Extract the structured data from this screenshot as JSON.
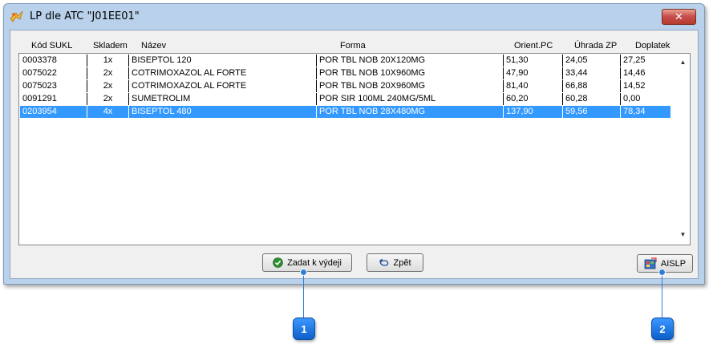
{
  "window": {
    "title": "LP dle ATC \"J01EE01\"",
    "close_label": "✕"
  },
  "columns": [
    "Kód SUKL",
    "Skladem",
    "Název",
    "Forma",
    "Orient.PC",
    "Úhrada ZP",
    "Doplatek"
  ],
  "rows": [
    [
      "0003378",
      "1x",
      "BISEPTOL 120",
      "POR TBL NOB 20X120MG",
      "51,30",
      "24,05",
      "27,25"
    ],
    [
      "0075022",
      "2x",
      "COTRIMOXAZOL AL FORTE",
      "POR TBL NOB 10X960MG",
      "47,90",
      "33,44",
      "14,46"
    ],
    [
      "0075023",
      "2x",
      "COTRIMOXAZOL AL FORTE",
      "POR TBL NOB 20X960MG",
      "81,40",
      "66,88",
      "14,52"
    ],
    [
      "0091291",
      "2x",
      "SUMETROLIM",
      "POR SIR 100ML 240MG/5ML",
      "60,20",
      "60,28",
      "0,00"
    ],
    [
      "0203954",
      "4x",
      "BISEPTOL 480",
      "POR TBL NOB 28X480MG",
      "137,90",
      "59,56",
      "78,34"
    ]
  ],
  "selected_row": 4,
  "buttons": {
    "zadat": "Zadat k výdeji",
    "zpet": "Zpět",
    "aislp": "AISLP"
  },
  "callouts": [
    "1",
    "2"
  ],
  "colors": {
    "selection": "#3399ff",
    "callout": "#1f78e0"
  }
}
